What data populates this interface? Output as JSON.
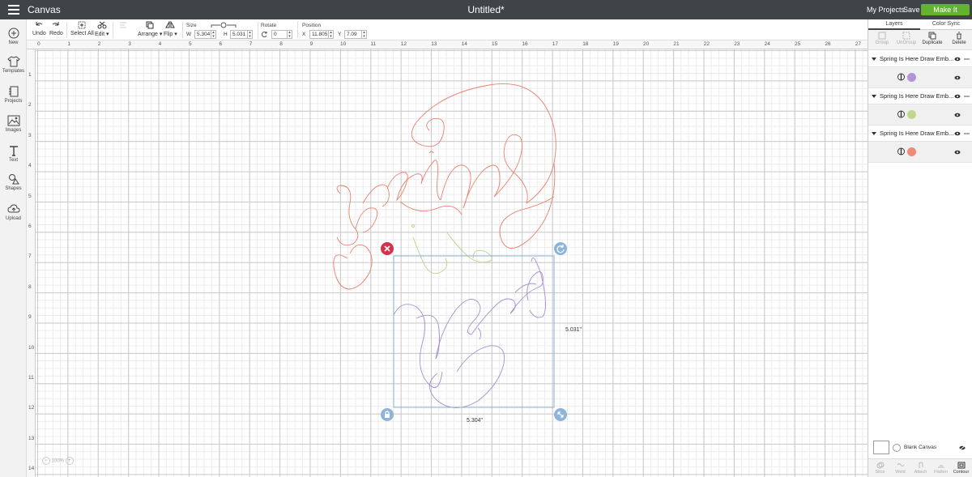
{
  "topbar": {
    "app_title": "Canvas",
    "doc_title": "Untitled*",
    "my_projects": "My Projects",
    "save": "Save",
    "make_it": "Make It",
    "make_it_color": "#63b32e"
  },
  "toolbar": {
    "undo": "Undo",
    "redo": "Redo",
    "select_all": "Select All",
    "edit": "Edit ▾",
    "arrange": "Arrange ▾",
    "flip": "Flip ▾",
    "size_label": "Size",
    "w_label": "W",
    "w_value": "5.304",
    "h_label": "H",
    "h_value": "5.031",
    "rotate_label": "Rotate",
    "rotate_value": "0",
    "position_label": "Position",
    "x_label": "X",
    "x_value": "11.805",
    "y_label": "Y",
    "y_value": "7.09"
  },
  "leftbar": {
    "items": [
      {
        "label": "New",
        "icon": "plus-circle-icon"
      },
      {
        "label": "Templates",
        "icon": "tshirt-icon"
      },
      {
        "label": "Projects",
        "icon": "notebook-icon"
      },
      {
        "label": "Images",
        "icon": "image-icon"
      },
      {
        "label": "Text",
        "icon": "text-icon"
      },
      {
        "label": "Shapes",
        "icon": "shapes-icon"
      },
      {
        "label": "Upload",
        "icon": "cloud-upload-icon"
      }
    ]
  },
  "rulers": {
    "top": [
      "0",
      "1",
      "2",
      "3",
      "4",
      "5",
      "6",
      "7",
      "8",
      "9",
      "10",
      "11",
      "12",
      "13",
      "14",
      "15",
      "16",
      "17",
      "18",
      "19",
      "20",
      "21",
      "22",
      "23",
      "24",
      "25",
      "26",
      "27"
    ],
    "left": [
      "1",
      "2",
      "3",
      "4",
      "5",
      "6",
      "7",
      "8",
      "9",
      "10",
      "11",
      "12",
      "13",
      "14"
    ]
  },
  "canvas": {
    "width_label": "5.304\"",
    "height_label": "5.031\"",
    "zoom": "100%",
    "colors": {
      "pink": "#e8806f",
      "purple": "#a68fd1",
      "green": "#b8d28a"
    }
  },
  "rightpanel": {
    "tab_layers": "Layers",
    "tab_color_sync": "Color Sync",
    "actions": [
      "Group",
      "UnGroup",
      "Duplicate",
      "Delete"
    ],
    "layers": [
      {
        "title": "Spring Is Here Draw Emb...",
        "color": "#b295d6"
      },
      {
        "title": "Spring Is Here Draw Emb...",
        "color": "#c0d88c"
      },
      {
        "title": "Spring Is Here Draw Emb...",
        "color": "#ef8a77"
      }
    ],
    "blank_canvas": "Blank Canvas",
    "bottom_actions": [
      "Slice",
      "Weld",
      "Attach",
      "Flatten",
      "Contour"
    ]
  }
}
